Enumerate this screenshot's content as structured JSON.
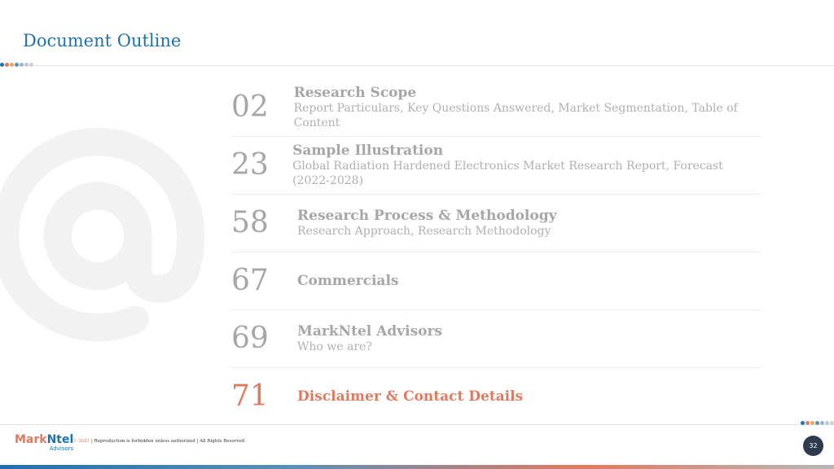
{
  "header": {
    "title": "Document Outline"
  },
  "decor": {
    "dot_colors": [
      "#1d72aa",
      "#e07a5f",
      "#f0a35e",
      "#5a8fb8",
      "#9ab3c9",
      "#b8c9d8",
      "#d0d0d0"
    ],
    "at_color": "#f2f2f2"
  },
  "outline": {
    "items": [
      {
        "number": "02",
        "heading": "Research Scope",
        "sub": "Report Particulars, Key Questions Answered, Market Segmentation, Table of Content",
        "active": false
      },
      {
        "number": "23",
        "heading": "Sample Illustration",
        "sub": "Global Radiation Hardened Electronics Market Research Report, Forecast (2022-2028)",
        "active": false
      },
      {
        "number": "58",
        "heading": "Research Process & Methodology",
        "sub": "Research Approach, Research Methodology",
        "active": false
      },
      {
        "number": "67",
        "heading": "Commercials",
        "sub": "",
        "active": false
      },
      {
        "number": "69",
        "heading": "MarkNtel Advisors",
        "sub": "Who we are?",
        "active": false
      },
      {
        "number": "71",
        "heading": "Disclaimer & Contact Details",
        "sub": "",
        "active": true
      }
    ],
    "active_color": "#e07a5f"
  },
  "footer": {
    "logo_mark": "Mark",
    "logo_ntel": "Ntel",
    "logo_sub": "Advisors",
    "copyright_year": "© 2021",
    "copyright_text": " | Reproduction is forbidden unless authorized | All Rights Reserved",
    "page_number": "32"
  }
}
